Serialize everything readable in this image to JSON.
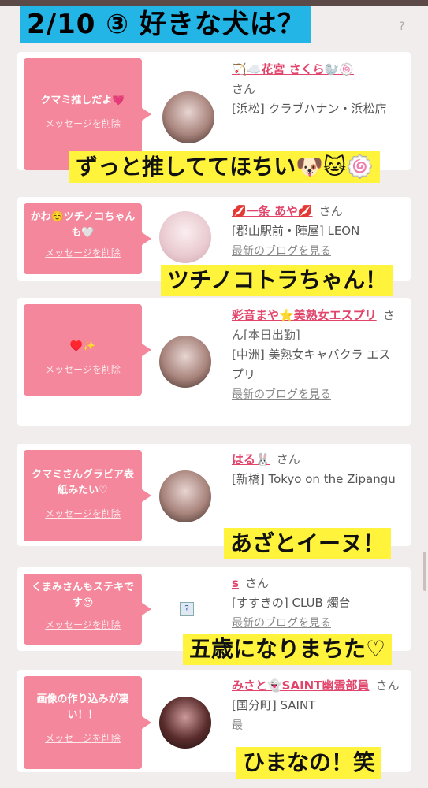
{
  "banner": {
    "title": "2/10 ③ 好きな犬は？",
    "q_mark": "?"
  },
  "cards": [
    {
      "message": "クマミ推しだよ💗",
      "delete": "メッセージを削除",
      "name": "🏹☁️花宮 さくら🦭🍥",
      "san": "さん",
      "shop": "[浜松] クラブハナン・浜松店",
      "blog": ""
    },
    {
      "message": "かわ☺️ツチノコちゃんも🤍",
      "delete": "メッセージを削除",
      "name": "💋一条 あや💋",
      "san": "さん",
      "shop": "[郡山駅前・陣屋] LEON",
      "blog": "最新のブログを見る"
    },
    {
      "message": "♥️✨",
      "delete": "メッセージを削除",
      "name": "彩音まや⭐美熟女エスプリ",
      "san": "さん[本日出勤]",
      "shop": "[中洲] 美熟女キャバクラ エスプリ",
      "blog": "最新のブログを見る"
    },
    {
      "message": "クマミさんグラビア表紙みたい♡",
      "delete": "メッセージを削除",
      "name": "はる🐰",
      "san": "さん",
      "shop": "[新橋] Tokyo on the Zipangu",
      "blog": ""
    },
    {
      "message": "くまみさんもステキです😍",
      "delete": "メッセージを削除",
      "name": "s",
      "san": "さん",
      "shop": "[すすきの] CLUB 燭台",
      "blog": "最新のブログを見る"
    },
    {
      "message": "画像の作り込みが凄い！！",
      "delete": "メッセージを削除",
      "name": "みさと👻SAINT幽霊部員",
      "san": "さん",
      "shop": "[国分町] SAINT",
      "blog": "最"
    }
  ],
  "captions": [
    "ずっと推しててほちい🐶🐱🍥",
    "ツチノコトラちゃん！",
    "あざとイーヌ！",
    "五歳になりまちた♡",
    "ひまなの！笑"
  ],
  "colors": {
    "bubble": "#f4879b",
    "name": "#e2456b",
    "banner": "#22b5e6",
    "caption": "#fff33b"
  }
}
